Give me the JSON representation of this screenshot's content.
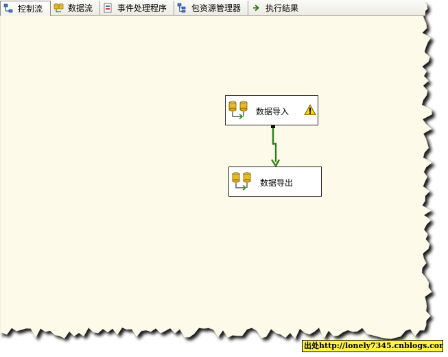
{
  "tabs": [
    {
      "label": "控制流",
      "icon": "control-flow-icon",
      "active": true
    },
    {
      "label": "数据流",
      "icon": "data-flow-icon",
      "active": false
    },
    {
      "label": "事件处理程序",
      "icon": "event-handlers-icon",
      "active": false
    },
    {
      "label": "包资源管理器",
      "icon": "package-explorer-icon",
      "active": false
    },
    {
      "label": "执行结果",
      "icon": "progress-arrow-icon",
      "active": false
    }
  ],
  "canvas": {
    "background_color": "#fdfae9",
    "tasks": [
      {
        "label": "数据导入",
        "icon": "data-flow-task-icon",
        "has_warning": true
      },
      {
        "label": "数据导出",
        "icon": "data-flow-task-icon",
        "has_warning": false
      }
    ],
    "precedence_constraint": {
      "from": "数据导入",
      "to": "数据导出",
      "status": "success",
      "color": "#2f7d1b"
    },
    "warning_icon": "warning-icon"
  },
  "watermark": {
    "text": "出处http://lonely7345.cnblogs.com"
  }
}
